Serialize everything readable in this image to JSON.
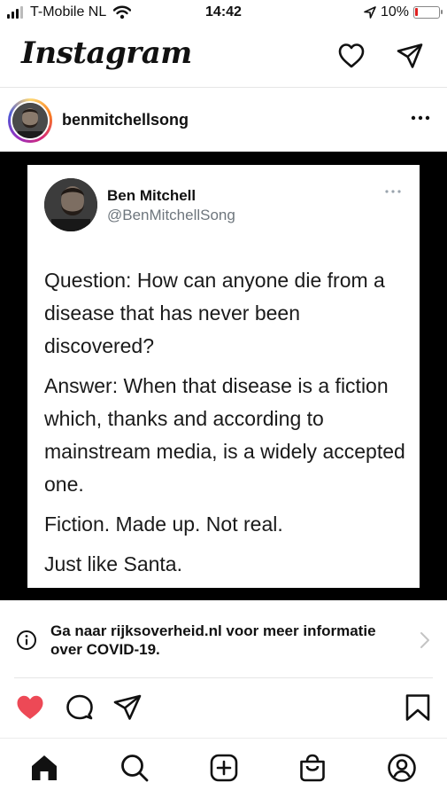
{
  "status_bar": {
    "carrier": "T-Mobile NL",
    "time": "14:42",
    "battery": "10%",
    "battery_level": 0.1
  },
  "header": {
    "logo": "Instagram",
    "icons": [
      "heart-icon",
      "direct-message-icon"
    ]
  },
  "post": {
    "username": "benmitchellsong",
    "more_icon": "more-dots-icon"
  },
  "tweet": {
    "name": "Ben Mitchell",
    "handle": "@BenMitchellSong",
    "paragraphs": [
      "Question: How can anyone die from a disease that has never been discovered?",
      "Answer: When that disease is a fiction which, thanks and according to mainstream media, is a widely accepted one.",
      "Fiction. Made up. Not real.",
      "Just like Santa."
    ]
  },
  "covid_banner": {
    "text": "Ga naar rijksoverheid.nl voor meer informatie over COVID-19."
  },
  "actions": {
    "liked": true,
    "like_color": "#ed4956",
    "icons": [
      "heart-icon",
      "comment-icon",
      "share-icon",
      "bookmark-icon"
    ]
  },
  "tab_bar": {
    "icons": [
      "home-icon",
      "search-icon",
      "new-post-icon",
      "shop-icon",
      "profile-icon"
    ]
  }
}
